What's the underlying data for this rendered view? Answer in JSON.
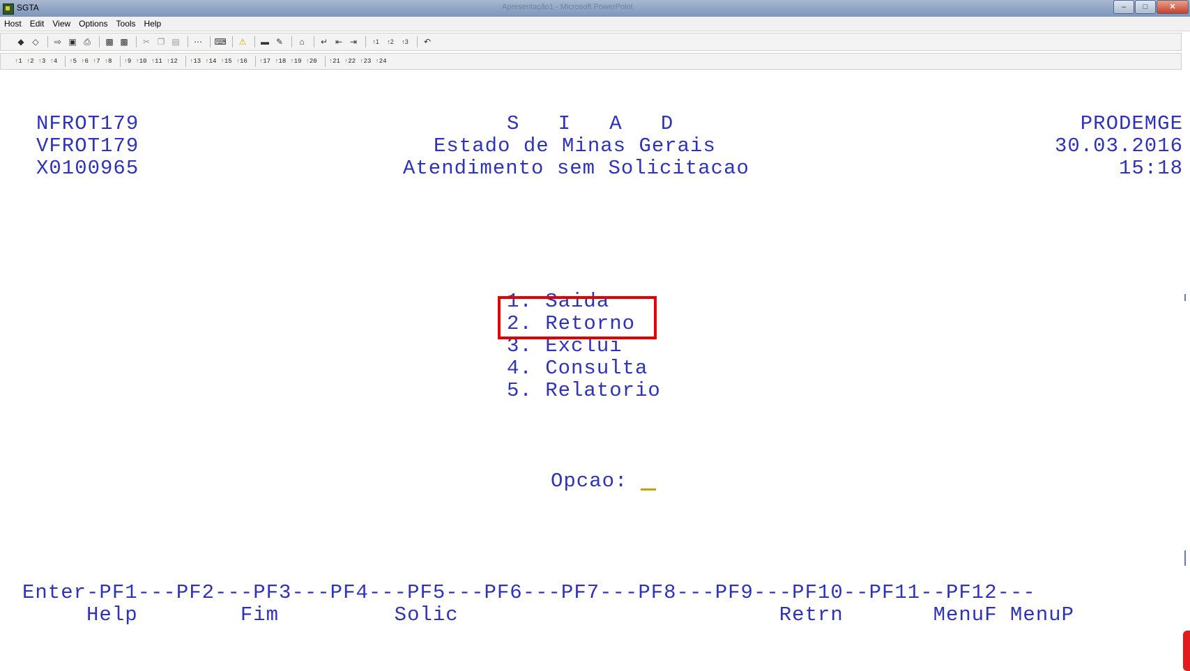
{
  "window": {
    "title": "SGTA",
    "background_title": "Apresentação1 - Microsoft PowerPoint"
  },
  "menu": [
    "Host",
    "Edit",
    "View",
    "Options",
    "Tools",
    "Help"
  ],
  "toolbar_icons": [
    "connect-icon",
    "disconnect-icon",
    "send-icon",
    "receive-icon",
    "print-icon",
    "copy-screen-icon",
    "paste-screen-icon",
    "cut-icon",
    "copy-icon",
    "paste-icon",
    "macro-icon",
    "keyboard-map-icon",
    "warning-icon",
    "display-icon",
    "edit-icon",
    "home-icon",
    "enter-icon",
    "backtab-icon",
    "tab-icon",
    "pa1-icon",
    "pa2-icon",
    "pa3-icon",
    "undo-icon"
  ],
  "pf_keys": [
    "1",
    "2",
    "3",
    "4",
    "5",
    "6",
    "7",
    "8",
    "9",
    "10",
    "11",
    "12",
    "13",
    "14",
    "15",
    "16",
    "17",
    "18",
    "19",
    "20",
    "21",
    "22",
    "23",
    "24"
  ],
  "screen": {
    "program_id_1": "NFROT179",
    "program_id_2": "VFROT179",
    "user_id": "X0100965",
    "system_name": "S   I   A   D",
    "state": "Estado de Minas Gerais",
    "screen_title": "Atendimento sem Solicitacao",
    "org": "PRODEMGE",
    "date": "30.03.2016",
    "time": "15:18",
    "options": [
      "1. Saida",
      "2. Retorno",
      "3. Exclui",
      "4. Consulta",
      "5. Relatorio"
    ],
    "prompt_label": "Opcao:",
    "pf_line": "Enter-PF1---PF2---PF3---PF4---PF5---PF6---PF7---PF8---PF9---PF10--PF11--PF12---",
    "pf_labels": "     Help        Fim         Solic                         Retrn       MenuF MenuP"
  },
  "colors": {
    "terminal_text": "#2e33b8",
    "highlight": "#e10000",
    "cursor": "#c8a000"
  }
}
